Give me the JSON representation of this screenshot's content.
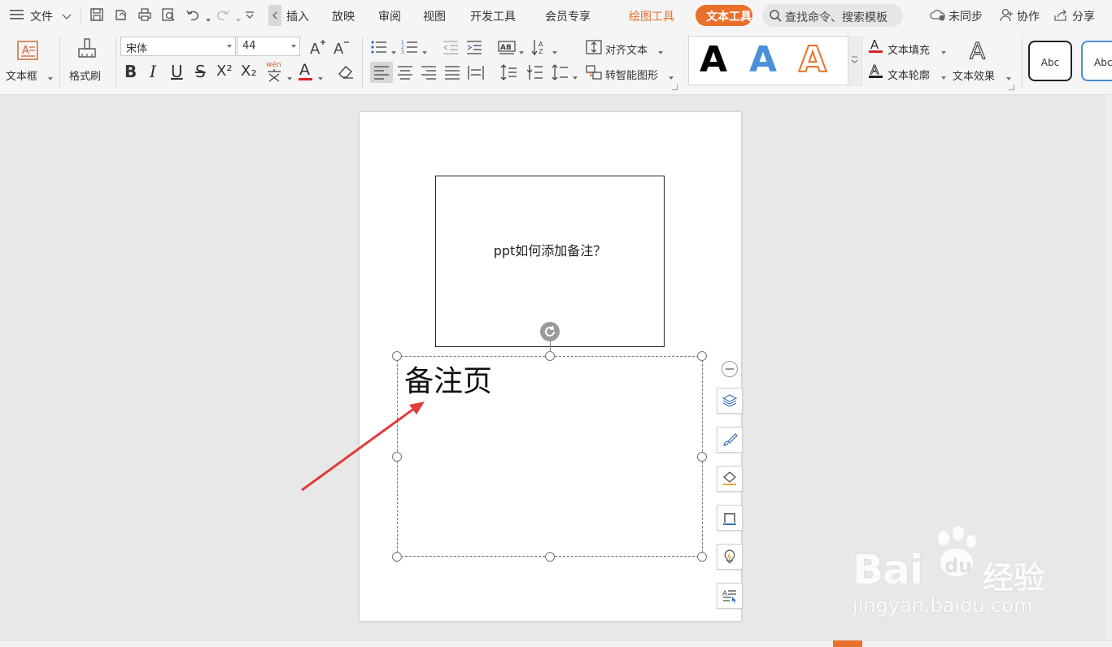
{
  "menubar": {
    "file_label": "文件",
    "tabs": [
      "插入",
      "放映",
      "审阅",
      "视图",
      "开发工具",
      "会员专享"
    ],
    "drawing_tools": "绘图工具",
    "text_tools": "文本工具",
    "search_placeholder": "查找命令、搜索模板",
    "sync": "未同步",
    "collab": "协作",
    "share": "分享"
  },
  "ribbon": {
    "textbox_label": "文本框",
    "format_painter_label": "格式刷",
    "font_name": "宋体",
    "font_size": "44",
    "align_text_label": "对齐文本",
    "smartart_label": "转智能图形",
    "text_fill_label": "文本填充",
    "text_outline_label": "文本轮廓",
    "text_effect_label": "文本效果",
    "style_preview": "Abc",
    "style_preview2": "Abc",
    "big_a": "A",
    "bold": "B",
    "italic": "I",
    "underline": "U",
    "strike": "S",
    "superscript": "X²",
    "subscript": "X₂",
    "pinyin": "wén",
    "font_color": "A"
  },
  "slide": {
    "title": "ppt如何添加备注？",
    "notes_text": "备注页"
  },
  "watermark": {
    "brand": "Bai",
    "brand2": "du",
    "brand_cn": "经验",
    "url": "jingyan.baidu.com"
  },
  "colors": {
    "accent_orange": "#e8702a",
    "arrow_red": "#e03c3c",
    "fill_blue": "#4a90d9"
  }
}
